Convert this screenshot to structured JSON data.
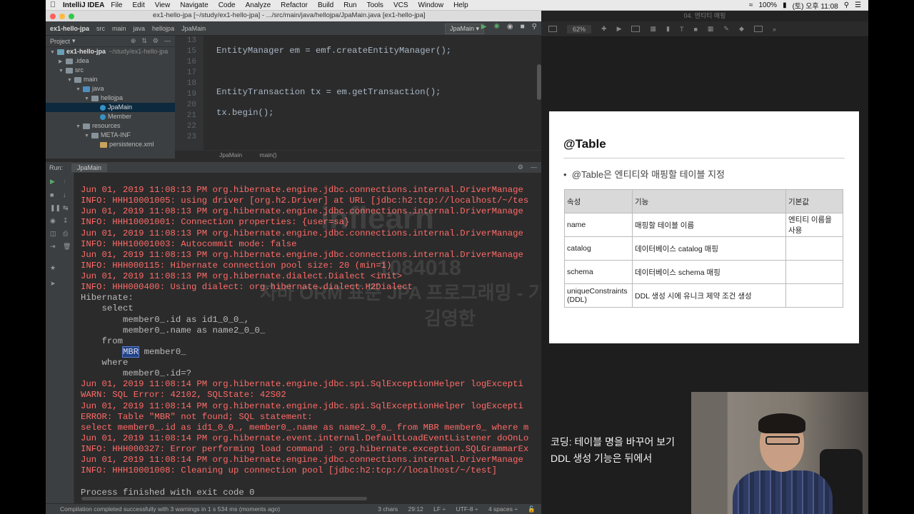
{
  "menubar": {
    "app": "IntelliJ IDEA",
    "items": [
      "File",
      "Edit",
      "View",
      "Navigate",
      "Code",
      "Analyze",
      "Refactor",
      "Build",
      "Run",
      "Tools",
      "VCS",
      "Window",
      "Help"
    ],
    "battery": "100%",
    "clock": "(토) 오후 11:08"
  },
  "ide": {
    "window_title": "ex1-hello-jpa [~/study/ex1-hello-jpa] - .../src/main/java/hellojpa/JpaMain.java [ex1-hello-jpa]",
    "breadcrumbs": [
      "ex1-hello-jpa",
      "src",
      "main",
      "java",
      "hellojpa",
      "JpaMain"
    ],
    "run_config": "JpaMain",
    "project_label": "Project",
    "tree": [
      {
        "label": "ex1-hello-jpa",
        "note": "~/study/ex1-hello-jpa",
        "depth": 0,
        "icon": "module-folder-icon",
        "open": true
      },
      {
        "label": ".idea",
        "depth": 1,
        "icon": "folder-icon",
        "open": false
      },
      {
        "label": "src",
        "depth": 1,
        "icon": "folder-icon",
        "open": true
      },
      {
        "label": "main",
        "depth": 2,
        "icon": "folder-icon",
        "open": true
      },
      {
        "label": "java",
        "depth": 3,
        "icon": "source-folder-icon",
        "open": true
      },
      {
        "label": "hellojpa",
        "depth": 4,
        "icon": "package-folder-icon",
        "open": true
      },
      {
        "label": "JpaMain",
        "depth": 5,
        "icon": "class-icon",
        "selected": true
      },
      {
        "label": "Member",
        "depth": 5,
        "icon": "class-icon"
      },
      {
        "label": "resources",
        "depth": 3,
        "icon": "folder-icon",
        "open": true
      },
      {
        "label": "META-INF",
        "depth": 4,
        "icon": "folder-icon",
        "open": true
      },
      {
        "label": "persistence.xml",
        "depth": 5,
        "icon": "xml-file-icon"
      }
    ],
    "line_numbers": [
      "13",
      "15",
      "16",
      "17",
      "18",
      "19",
      "20",
      "21",
      "22",
      "23"
    ],
    "editor_breadcrumb": [
      "JpaMain",
      "main()"
    ],
    "run_label": "Run:",
    "run_tab": "JpaMain",
    "status_message": "Compilation completed successfully with 3 warnings in 1 s 534 ms (moments ago)",
    "status_right": [
      "3 chars",
      "29:12",
      "LF ÷",
      "UTF-8 ÷",
      "4 spaces ÷"
    ]
  },
  "console_lines": [
    {
      "kind": "err",
      "text": "Jun 01, 2019 11:08:13 PM org.hibernate.engine.jdbc.connections.internal.DriverManage"
    },
    {
      "kind": "err",
      "text": "INFO: HHH10001005: using driver [org.h2.Driver] at URL [jdbc:h2:tcp://localhost/~/tes"
    },
    {
      "kind": "err",
      "text": "Jun 01, 2019 11:08:13 PM org.hibernate.engine.jdbc.connections.internal.DriverManage"
    },
    {
      "kind": "err",
      "text": "INFO: HHH10001001: Connection properties: {user=sa}"
    },
    {
      "kind": "err",
      "text": "Jun 01, 2019 11:08:13 PM org.hibernate.engine.jdbc.connections.internal.DriverManage"
    },
    {
      "kind": "err",
      "text": "INFO: HHH10001003: Autocommit mode: false"
    },
    {
      "kind": "err",
      "text": "Jun 01, 2019 11:08:13 PM org.hibernate.engine.jdbc.connections.internal.DriverManage"
    },
    {
      "kind": "err",
      "text": "INFO: HHH000115: Hibernate connection pool size: 20 (min=1)"
    },
    {
      "kind": "err",
      "text": "Jun 01, 2019 11:08:13 PM org.hibernate.dialect.Dialect <init>"
    },
    {
      "kind": "err",
      "text": "INFO: HHH000400: Using dialect: org.hibernate.dialect.H2Dialect"
    },
    {
      "kind": "out",
      "text": "Hibernate:"
    },
    {
      "kind": "out",
      "text": "    select"
    },
    {
      "kind": "out",
      "text": "        member0_.id as id1_0_0_,"
    },
    {
      "kind": "out",
      "text": "        member0_.name as name2_0_0_"
    },
    {
      "kind": "out",
      "text": "    from"
    },
    {
      "kind": "out",
      "text": "        MBR member0_"
    },
    {
      "kind": "out",
      "text": "    where"
    },
    {
      "kind": "out",
      "text": "        member0_.id=?"
    },
    {
      "kind": "err",
      "text": "Jun 01, 2019 11:08:14 PM org.hibernate.engine.jdbc.spi.SqlExceptionHelper logExcepti"
    },
    {
      "kind": "err",
      "text": "WARN: SQL Error: 42102, SQLState: 42S02"
    },
    {
      "kind": "err",
      "text": "Jun 01, 2019 11:08:14 PM org.hibernate.engine.jdbc.spi.SqlExceptionHelper logExcepti"
    },
    {
      "kind": "err",
      "text": "ERROR: Table \"MBR\" not found; SQL statement:"
    },
    {
      "kind": "err",
      "text": "select member0_.id as id1_0_0_, member0_.name as name2_0_0_ from MBR member0_ where m"
    },
    {
      "kind": "err",
      "text": "Jun 01, 2019 11:08:14 PM org.hibernate.event.internal.DefaultLoadEventListener doOnLo"
    },
    {
      "kind": "err",
      "text": "INFO: HHH000327: Error performing load command : org.hibernate.exception.SQLGrammarEx"
    },
    {
      "kind": "err",
      "text": "Jun 01, 2019 11:08:14 PM org.hibernate.engine.jdbc.connections.internal.DriverManage"
    },
    {
      "kind": "err",
      "text": "INFO: HHH10001008: Cleaning up connection pool [jdbc:h2:tcp://localhost/~/test]"
    },
    {
      "kind": "out",
      "text": ""
    },
    {
      "kind": "out",
      "text": "Process finished with exit code 0"
    }
  ],
  "watermark": {
    "brand": "inflearn",
    "id": "1084018",
    "course": "자바 ORM 표준 JPA 프로그래밍 - 기본편",
    "name": "김영한"
  },
  "keynote": {
    "window_title": "04. 엔티티 매핑",
    "zoom": "62%",
    "slide_title": "@Table",
    "bullet": "@Table은 엔티티와 매핑할 테이블 지정",
    "table_headers": [
      "속성",
      "기능",
      "기본값"
    ],
    "table_rows": [
      [
        "name",
        "매핑할 테이블 이름",
        "엔티티 이름을 사용"
      ],
      [
        "catalog",
        "데이터베이스 catalog 매핑",
        ""
      ],
      [
        "schema",
        "데이터베이스 schema 매핑",
        ""
      ],
      [
        "uniqueConstraints (DDL)",
        "DDL 생성 시에 유니크 제약 조건 생성",
        ""
      ]
    ]
  },
  "caption": {
    "line1": "코딩: 테이블 명을 바꾸어 보기",
    "line2": "DDL 생성 기능은 뒤에서"
  }
}
